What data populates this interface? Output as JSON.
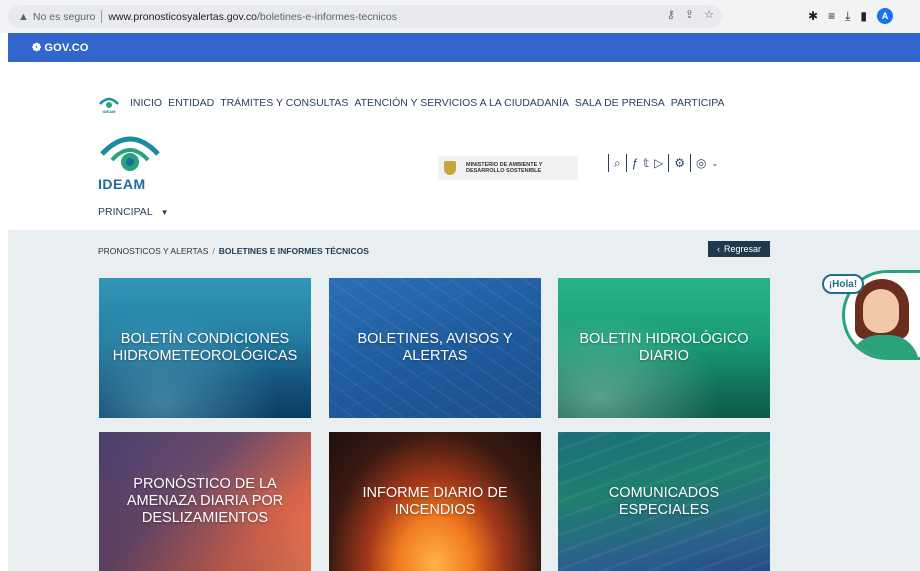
{
  "browser": {
    "security_label": "No es seguro",
    "url_host": "www.pronosticosyalertas.gov.co",
    "url_path": "/boletines-e-informes-tecnicos",
    "profile_initial": "A"
  },
  "govbar": {
    "label": "GOV.CO"
  },
  "header": {
    "topnav": [
      "INICIO",
      "ENTIDAD",
      "TRÁMITES Y CONSULTAS",
      "ATENCIÓN Y SERVICIOS A LA CIUDADANÍA",
      "SALA DE PRENSA",
      "PARTICIPA"
    ],
    "mini_logo_text": "IDEAM",
    "brand_name": "IDEAM",
    "ministry_line1": "MINISTERIO DE AMBIENTE Y",
    "ministry_line2": "DESARROLLO SOSTENIBLE",
    "principal_label": "PRINCIPAL"
  },
  "breadcrumb": {
    "parent": "PRONOSTICOS Y ALERTAS",
    "separator": "/",
    "current": "BOLETINES E INFORMES TÉCNICOS"
  },
  "back_button": {
    "label": "Regresar"
  },
  "cards": [
    {
      "label": "BOLETÍN CONDICIONES HIDROMETEOROLÓGICAS"
    },
    {
      "label": "BOLETINES, AVISOS Y ALERTAS"
    },
    {
      "label": "BOLETIN HIDROLÓGICO DIARIO"
    },
    {
      "label": "PRONÓSTICO DE LA AMENAZA DIARIA POR DESLIZAMIENTOS"
    },
    {
      "label": "INFORME DIARIO DE INCENDIOS"
    },
    {
      "label": "COMUNICADOS ESPECIALES"
    }
  ],
  "chat": {
    "greeting": "¡Hola!"
  },
  "colors": {
    "gov_blue": "#3366cc",
    "nav_text": "#2a3f5f",
    "back_button_bg": "#1f3a4d",
    "content_bg": "#e9eef0",
    "chat_green": "#2aa37a"
  }
}
